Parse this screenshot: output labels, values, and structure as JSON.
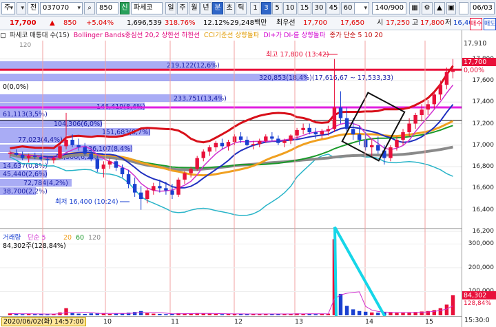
{
  "toolbar": {
    "market_selector": "주",
    "market_icon": "dropdown-icon",
    "prev_label": "전",
    "stock_code": "037070",
    "quantity_value": "850",
    "sin_badge": "신",
    "stock_name": "파세코",
    "period_buttons": [
      "일",
      "주",
      "월",
      "년",
      "분",
      "초",
      "틱"
    ],
    "active_period": "분",
    "interval_buttons": [
      "1",
      "3",
      "5",
      "10",
      "15",
      "30",
      "45",
      "60"
    ],
    "active_interval": "3",
    "interval_select": "3",
    "count_value": "140/900",
    "date_value": "06/03"
  },
  "quote": {
    "current_price": "17,700",
    "change": "850",
    "change_pct": "+5.04%",
    "volume": "1,696,539",
    "volume_ratio": "318.76%",
    "turnover_pct": "12.12%",
    "amount": "29,248백만",
    "best_label": "최우선",
    "best_price": "17,700",
    "open": "17,650",
    "high_label": "시",
    "high": "17,250",
    "high2_label": "고",
    "high2": "17,800",
    "low_label": "저",
    "low": "16,400",
    "buy_button": "매수",
    "sell_button": "매도"
  },
  "legend": {
    "items": [
      {
        "text": "파세코 매통대 수(15)",
        "color": "#222222"
      },
      {
        "text": "Bollinger Bands중심선 20,2 상한선 하한선",
        "color": "#e0007a"
      },
      {
        "text": "CCI기준선 상향돌파",
        "color": "#e09a00"
      },
      {
        "text": "DI+가 DI-를 상향돌파",
        "color": "#d000d0"
      },
      {
        "text": "종가 단순 5 10 20",
        "color": "#c00000"
      }
    ],
    "small_number": "120"
  },
  "chart_annotations": {
    "high_marker": "최고 17,800 (13:42)",
    "low_marker": "최저 16,400 (10:24)",
    "zero_label": "0(0,0%)",
    "volume_profile": [
      "219,122(12,6%)",
      "320,853(18,4%)(17,616,67 ~ 17,533,33)",
      "233,751(13,4%)",
      "146,419(8,4%)",
      "61,113(3,5%)",
      "104,306(6,0%)",
      "151,683(8,7%)",
      "77,023(4,4%)",
      "136,107(8,4%)",
      "61,306(6,2%)",
      "14,637(0,8%)",
      "45,440(2,6%)",
      "72,784(4,2%)",
      "38,700(2,2%)"
    ]
  },
  "volume_panel": {
    "title": "거래량",
    "ma_label": "단순 5",
    "ma_periods": [
      "20",
      "60",
      "120"
    ],
    "last_volume": "84,302주(128,84%)"
  },
  "y_axis": {
    "price_ticks": [
      "17,800",
      "17,600",
      "17,400",
      "17,200",
      "17,000",
      "16,800",
      "16,600",
      "16,400",
      "16,200"
    ],
    "price_tag": "17,700",
    "price_tag_pct": "0,00%",
    "top_tag": "17,910",
    "volume_ticks": [
      "300,000",
      "200,000",
      "100,000"
    ],
    "volume_tag": "84,302",
    "volume_tag_pct": "128,84%"
  },
  "x_axis": {
    "date_badge": "2020/06/02(화) 14:57:00",
    "ticks": [
      "10",
      "11",
      "12",
      "13",
      "14",
      "15"
    ],
    "time_badge": "15:30:0"
  },
  "chart_data": {
    "type": "candlestick",
    "title": "파세코 037070 3분봉",
    "ylim": [
      16200,
      17900
    ],
    "reference_lines": [
      {
        "label": "219,122(12,6%)",
        "value": 17700,
        "color": "#e8103a"
      },
      {
        "label": "233,751(13,4%)",
        "value": 17350,
        "color": "#e020e0"
      },
      {
        "label": "",
        "value": 17230,
        "color": "#000000"
      }
    ],
    "candles": [
      [
        16920,
        16950,
        16880,
        16930
      ],
      [
        16930,
        16960,
        16900,
        16910
      ],
      [
        16910,
        16940,
        16860,
        16880
      ],
      [
        16880,
        16920,
        16840,
        16900
      ],
      [
        16900,
        16930,
        16870,
        16890
      ],
      [
        16890,
        16920,
        16850,
        16870
      ],
      [
        16870,
        16900,
        16820,
        16860
      ],
      [
        16860,
        16900,
        16830,
        16880
      ],
      [
        16880,
        17000,
        16870,
        16990
      ],
      [
        16990,
        17300,
        16960,
        17050
      ],
      [
        17050,
        17100,
        16980,
        17000
      ],
      [
        17000,
        17060,
        16950,
        16980
      ],
      [
        16980,
        17020,
        16900,
        16920
      ],
      [
        16920,
        16960,
        16850,
        16870
      ],
      [
        16870,
        16900,
        16750,
        16780
      ],
      [
        16780,
        16850,
        16700,
        16820
      ],
      [
        16820,
        16880,
        16780,
        16850
      ],
      [
        16850,
        16870,
        16760,
        16790
      ],
      [
        16790,
        16820,
        16700,
        16730
      ],
      [
        16730,
        16770,
        16600,
        16640
      ],
      [
        16640,
        16700,
        16520,
        16560
      ],
      [
        16560,
        16620,
        16400,
        16500
      ],
      [
        16500,
        16600,
        16460,
        16580
      ],
      [
        16580,
        16650,
        16540,
        16620
      ],
      [
        16620,
        16680,
        16560,
        16600
      ],
      [
        16600,
        16660,
        16540,
        16580
      ],
      [
        16580,
        16640,
        16500,
        16540
      ],
      [
        16540,
        16700,
        16520,
        16680
      ],
      [
        16680,
        16760,
        16640,
        16740
      ],
      [
        16740,
        16800,
        16700,
        16780
      ],
      [
        16780,
        16900,
        16760,
        16880
      ],
      [
        16880,
        16960,
        16850,
        16940
      ],
      [
        16940,
        17000,
        16900,
        16980
      ],
      [
        16980,
        17040,
        16940,
        17020
      ],
      [
        17020,
        17060,
        16960,
        16990
      ],
      [
        16990,
        17050,
        16950,
        17030
      ],
      [
        17030,
        17100,
        17000,
        17080
      ],
      [
        17080,
        17120,
        17020,
        17050
      ],
      [
        17050,
        17080,
        16990,
        17000
      ],
      [
        17000,
        17040,
        16960,
        17010
      ],
      [
        17010,
        17060,
        16980,
        17040
      ],
      [
        17040,
        17100,
        17020,
        17080
      ],
      [
        17080,
        17120,
        17040,
        17060
      ],
      [
        17060,
        17090,
        17000,
        17020
      ],
      [
        17020,
        17060,
        16980,
        17040
      ],
      [
        17040,
        17100,
        17010,
        17090
      ],
      [
        17090,
        17160,
        17060,
        17140
      ],
      [
        17140,
        17200,
        17100,
        17160
      ],
      [
        17160,
        17200,
        17100,
        17120
      ],
      [
        17120,
        17160,
        17060,
        17100
      ],
      [
        17100,
        17150,
        17060,
        17130
      ],
      [
        17130,
        17180,
        17090,
        17150
      ],
      [
        17150,
        17800,
        17120,
        17350
      ],
      [
        17350,
        17500,
        17200,
        17250
      ],
      [
        17250,
        17350,
        17100,
        17150
      ],
      [
        17150,
        17250,
        17050,
        17100
      ],
      [
        17100,
        17180,
        17000,
        17050
      ],
      [
        17050,
        17120,
        16950,
        16980
      ],
      [
        16980,
        17060,
        16900,
        17000
      ],
      [
        17000,
        17080,
        16920,
        16950
      ],
      [
        16950,
        17000,
        16820,
        16880
      ],
      [
        16880,
        17000,
        16850,
        16980
      ],
      [
        16980,
        17080,
        16950,
        17050
      ],
      [
        17050,
        17150,
        17000,
        17120
      ],
      [
        17120,
        17250,
        17080,
        17200
      ],
      [
        17200,
        17300,
        17150,
        17280
      ],
      [
        17280,
        17380,
        17220,
        17330
      ],
      [
        17330,
        17420,
        17280,
        17380
      ],
      [
        17380,
        17500,
        17340,
        17470
      ],
      [
        17470,
        17600,
        17420,
        17560
      ],
      [
        17560,
        17720,
        17520,
        17680
      ],
      [
        17680,
        17800,
        17620,
        17700
      ]
    ],
    "volume": [
      8000,
      6000,
      5000,
      7000,
      5000,
      6000,
      4000,
      5000,
      12000,
      30000,
      9000,
      7000,
      6000,
      8000,
      10000,
      9000,
      6000,
      7000,
      8000,
      11000,
      14000,
      18000,
      9000,
      7000,
      6000,
      5000,
      7000,
      9000,
      8000,
      7000,
      9000,
      8000,
      7000,
      6000,
      5000,
      6000,
      7000,
      6000,
      5000,
      5000,
      6000,
      7000,
      6000,
      5000,
      5000,
      6000,
      8000,
      7000,
      6000,
      5000,
      6000,
      7000,
      320000,
      90000,
      40000,
      25000,
      18000,
      15000,
      12000,
      11000,
      14000,
      12000,
      10000,
      11000,
      12000,
      14000,
      16000,
      18000,
      22000,
      30000,
      45000,
      84302
    ]
  }
}
